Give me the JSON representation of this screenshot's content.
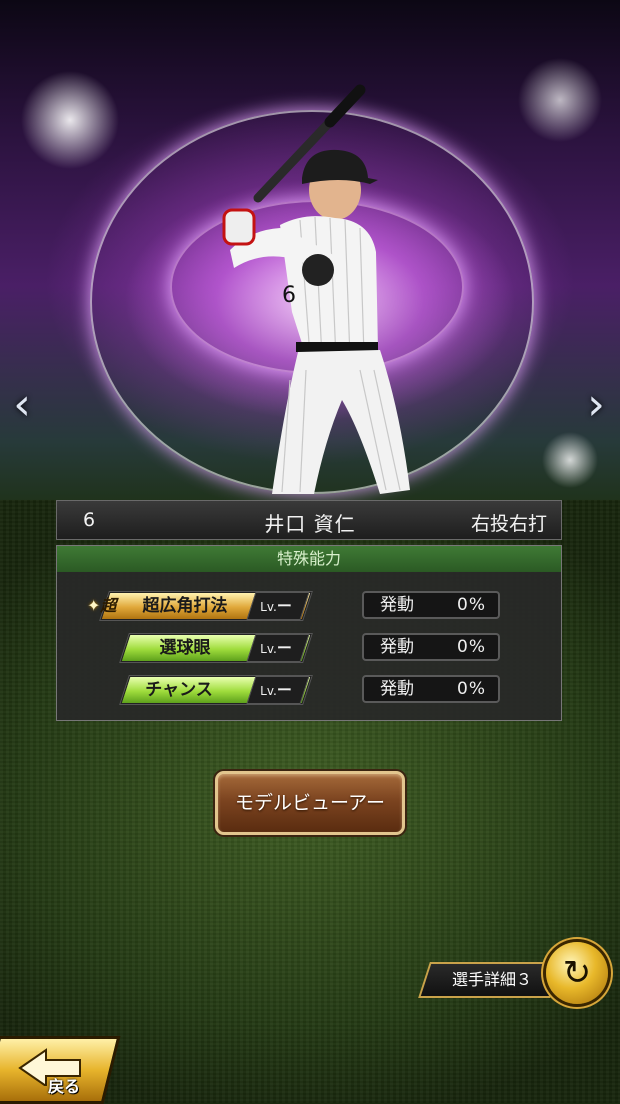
{
  "player": {
    "number": "6",
    "name": "井口 資仁",
    "handedness": "右投右打"
  },
  "abilities_panel": {
    "title": "特殊能力",
    "items": [
      {
        "super_mark": "超",
        "name": "超広角打法",
        "level_prefix": "Lv.",
        "level_value": "ー",
        "activation_label": "発動",
        "activation_value": "0%",
        "tier": "gold"
      },
      {
        "name": "選球眼",
        "level_prefix": "Lv.",
        "level_value": "ー",
        "activation_label": "発動",
        "activation_value": "0%",
        "tier": "green"
      },
      {
        "name": "チャンス",
        "level_prefix": "Lv.",
        "level_value": "ー",
        "activation_label": "発動",
        "activation_value": "0%",
        "tier": "green"
      }
    ]
  },
  "buttons": {
    "model_viewer": "モデルビューアー",
    "player_detail": "選手詳細３",
    "back": "戻る"
  },
  "icons": {
    "prev": "chevron-left-icon",
    "next": "chevron-right-icon",
    "refresh": "refresh-icon",
    "back": "back-arrow-icon"
  },
  "colors": {
    "ability_gold": "#e0a83a",
    "ability_green": "#9fdc3c",
    "panel_header": "#3f7a35",
    "button_brown": "#7c4420"
  }
}
